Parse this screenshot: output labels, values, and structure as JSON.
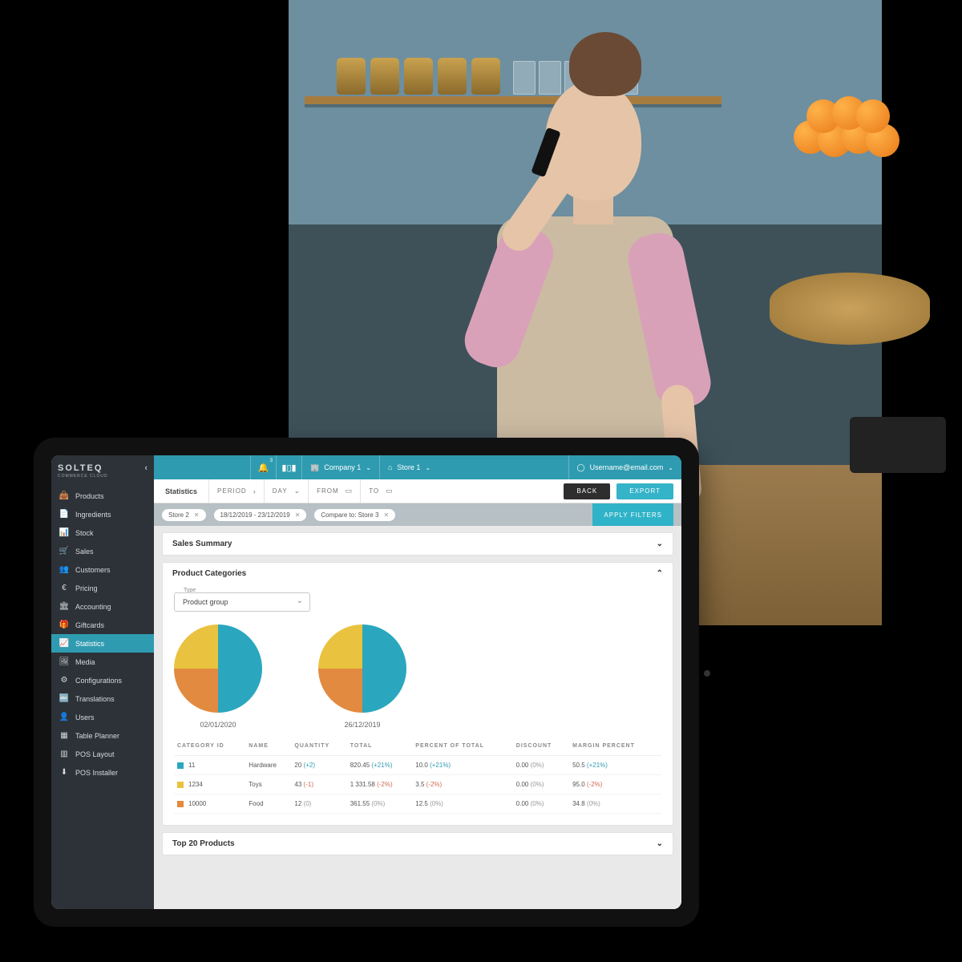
{
  "brand": {
    "name": "SOLTEQ",
    "subtitle": "COMMERCE CLOUD"
  },
  "sidebar": {
    "items": [
      {
        "icon": "bag",
        "label": "Products"
      },
      {
        "icon": "ingredient",
        "label": "Ingredients"
      },
      {
        "icon": "bars",
        "label": "Stock"
      },
      {
        "icon": "cart",
        "label": "Sales"
      },
      {
        "icon": "people",
        "label": "Customers"
      },
      {
        "icon": "euro",
        "label": "Pricing"
      },
      {
        "icon": "bank",
        "label": "Accounting"
      },
      {
        "icon": "gift",
        "label": "Giftcards"
      },
      {
        "icon": "chart",
        "label": "Statistics"
      },
      {
        "icon": "media",
        "label": "Media"
      },
      {
        "icon": "sliders",
        "label": "Configurations"
      },
      {
        "icon": "translate",
        "label": "Translations"
      },
      {
        "icon": "users",
        "label": "Users"
      },
      {
        "icon": "table",
        "label": "Table Planner"
      },
      {
        "icon": "layout",
        "label": "POS Layout"
      },
      {
        "icon": "installer",
        "label": "POS Installer"
      }
    ],
    "activeIndex": 8
  },
  "topbar": {
    "notifCount": "3",
    "company": "Company 1",
    "store": "Store 1",
    "user": "Username@email.com"
  },
  "filters": {
    "title": "Statistics",
    "period_label": "PERIOD",
    "day_label": "DAY",
    "from_label": "FROM",
    "to_label": "TO",
    "back": "BACK",
    "export": "EXPORT"
  },
  "chips": {
    "store": "Store 2",
    "range": "18/12/2019 - 23/12/2019",
    "compare": "Compare to: Store 3",
    "apply": "APPLY FILTERS"
  },
  "panels": {
    "sales_summary": "Sales Summary",
    "product_categories": "Product Categories",
    "top20": "Top 20 Products",
    "type_label": "Type",
    "type_value": "Product group"
  },
  "chart_data": [
    {
      "type": "pie",
      "title": "02/01/2020",
      "series": [
        {
          "name": "Hardware",
          "value": 50,
          "color": "#2aa7bf"
        },
        {
          "name": "Toys",
          "value": 25,
          "color": "#e28a3f"
        },
        {
          "name": "Food",
          "value": 25,
          "color": "#e9c23f"
        }
      ]
    },
    {
      "type": "pie",
      "title": "26/12/2019",
      "series": [
        {
          "name": "Hardware",
          "value": 50,
          "color": "#2aa7bf"
        },
        {
          "name": "Toys",
          "value": 25,
          "color": "#e28a3f"
        },
        {
          "name": "Food",
          "value": 25,
          "color": "#e9c23f"
        }
      ]
    }
  ],
  "table": {
    "headers": [
      "CATEGORY ID",
      "NAME",
      "QUANTITY",
      "TOTAL",
      "PERCENT OF TOTAL",
      "DISCOUNT",
      "MARGIN PERCENT"
    ],
    "rows": [
      {
        "color": "#2aa7bf",
        "id": "11",
        "name": "Hardware",
        "qty": "20",
        "qty_d": "(+2)",
        "qty_c": "pos",
        "total": "820.45",
        "total_d": "(+21%)",
        "total_c": "pos",
        "pct": "10.0",
        "pct_d": "(+21%)",
        "pct_c": "pos",
        "disc": "0.00",
        "disc_d": "(0%)",
        "disc_c": "zero",
        "margin": "50.5",
        "margin_d": "(+21%)",
        "margin_c": "pos"
      },
      {
        "color": "#e9c23f",
        "id": "1234",
        "name": "Toys",
        "qty": "43",
        "qty_d": "(-1)",
        "qty_c": "neg",
        "total": "1 331.58",
        "total_d": "(-2%)",
        "total_c": "neg",
        "pct": "3.5",
        "pct_d": "(-2%)",
        "pct_c": "neg",
        "disc": "0.00",
        "disc_d": "(0%)",
        "disc_c": "zero",
        "margin": "95.0",
        "margin_d": "(-2%)",
        "margin_c": "neg"
      },
      {
        "color": "#e28a3f",
        "id": "10000",
        "name": "Food",
        "qty": "12",
        "qty_d": "(0)",
        "qty_c": "zero",
        "total": "361.55",
        "total_d": "(0%)",
        "total_c": "zero",
        "pct": "12.5",
        "pct_d": "(0%)",
        "pct_c": "zero",
        "disc": "0.00",
        "disc_d": "(0%)",
        "disc_c": "zero",
        "margin": "34.8",
        "margin_d": "(0%)",
        "margin_c": "zero"
      }
    ]
  },
  "icons": {
    "bag": "👜",
    "ingredient": "📄",
    "bars": "📊",
    "cart": "🛒",
    "people": "👥",
    "euro": "€",
    "bank": "🏛",
    "gift": "🎁",
    "chart": "📈",
    "media": "🖼",
    "sliders": "⚙",
    "translate": "🔤",
    "users": "👤",
    "table": "▦",
    "layout": "▥",
    "installer": "⬇",
    "bell": "🔔",
    "barcode": "▮▯▮",
    "company": "🏢",
    "store": "⌂",
    "usericon": "◯",
    "calendar": "▭",
    "chev_r": "›",
    "chev_d": "⌄",
    "chev_u": "⌃",
    "close": "✕",
    "chev_l": "‹"
  }
}
